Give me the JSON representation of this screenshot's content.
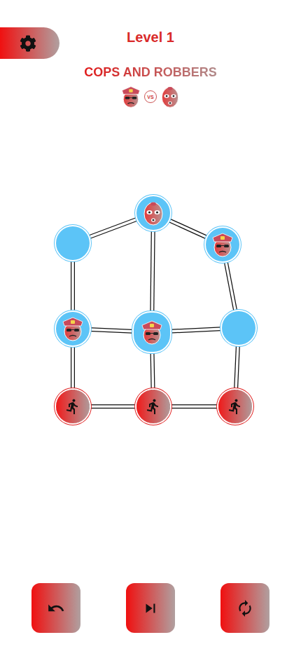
{
  "header": {
    "level": "Level 1",
    "title": "COPS AND ROBBERS",
    "versus": "VS"
  },
  "board": {
    "nodes": [
      {
        "kind": "robber",
        "selected": false
      },
      {
        "kind": "empty",
        "selected": false
      },
      {
        "kind": "cop",
        "selected": false
      },
      {
        "kind": "cop",
        "selected": false
      },
      {
        "kind": "cop",
        "selected": true
      },
      {
        "kind": "empty",
        "selected": false
      },
      {
        "kind": "exit",
        "selected": false
      },
      {
        "kind": "exit",
        "selected": false
      },
      {
        "kind": "exit",
        "selected": false
      }
    ],
    "edges": [
      [
        0,
        1
      ],
      [
        0,
        2
      ],
      [
        0,
        4
      ],
      [
        1,
        3
      ],
      [
        2,
        5
      ],
      [
        3,
        4
      ],
      [
        4,
        5
      ],
      [
        3,
        6
      ],
      [
        4,
        7
      ],
      [
        5,
        8
      ],
      [
        6,
        7
      ],
      [
        7,
        8
      ]
    ]
  }
}
